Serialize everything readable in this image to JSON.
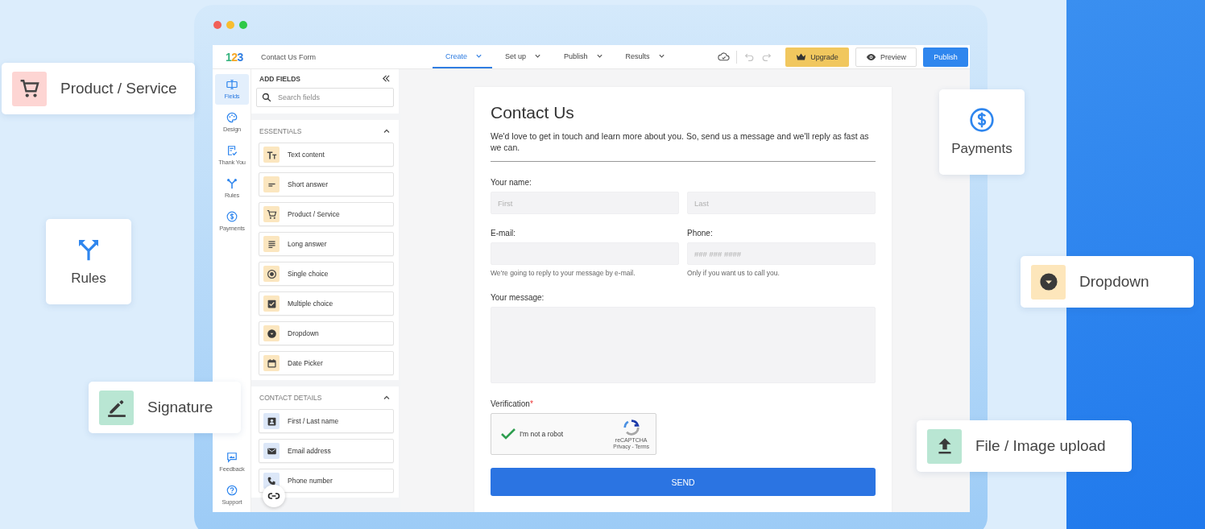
{
  "window": {
    "title": "Contact Us Form"
  },
  "logo": "123",
  "tabs": [
    {
      "label": "Create",
      "selected": true
    },
    {
      "label": "Set up",
      "selected": false
    },
    {
      "label": "Publish",
      "selected": false
    },
    {
      "label": "Results",
      "selected": false
    }
  ],
  "toolbar_buttons": [
    {
      "kind": "upgrade",
      "label": "Upgrade"
    },
    {
      "kind": "preview",
      "label": "Preview"
    },
    {
      "kind": "publish",
      "label": "Publish"
    }
  ],
  "rail": {
    "top_items": [
      {
        "label": "Fields",
        "selected": true
      },
      {
        "label": "Design",
        "selected": false
      },
      {
        "label": "Thank You",
        "selected": false
      },
      {
        "label": "Rules",
        "selected": false
      },
      {
        "label": "Payments",
        "selected": false
      }
    ],
    "bottom_items": [
      {
        "label": "Feedback",
        "selected": false
      },
      {
        "label": "Support",
        "selected": false
      }
    ]
  },
  "fields_panel": {
    "title": "ADD FIELDS",
    "search": {
      "placeholder": "Search fields"
    },
    "groups": [
      {
        "title": "ESSENTIALS",
        "expanded": true,
        "items": [
          "Text content",
          "Short answer",
          "Product / Service",
          "Long answer",
          "Single choice",
          "Multiple choice",
          "Dropdown",
          "Date Picker"
        ]
      },
      {
        "title": "CONTACT DETAILS",
        "expanded": true,
        "items": [
          "First / Last name",
          "Email address",
          "Phone number"
        ]
      }
    ]
  },
  "form": {
    "title": "Contact Us",
    "description": "We'd love to get in touch and learn more about you. So, send us a message and we'll reply as fast as we can.",
    "name_field": {
      "label": "Your name:",
      "first_placeholder": "First",
      "last_placeholder": "Last"
    },
    "email_field": {
      "label": "E-mail:",
      "hint": "We're going to reply to your message by e-mail."
    },
    "phone_field": {
      "label": "Phone:",
      "placeholder": "### ### ####",
      "hint": "Only if you want us to call you."
    },
    "message_field": {
      "label": "Your message:"
    },
    "verification": {
      "label": "Verification",
      "required_mark": "*",
      "captcha": {
        "checked": true,
        "label": "I'm not a robot",
        "brand": "reCAPTCHA",
        "links": "Privacy - Terms"
      }
    },
    "submit": "SEND"
  },
  "floating_cards": [
    {
      "kind": "row",
      "label": "Product / Service"
    },
    {
      "kind": "tile",
      "label": "Rules"
    },
    {
      "kind": "row",
      "label": "Signature"
    },
    {
      "kind": "tile",
      "label": "Payments"
    },
    {
      "kind": "row",
      "label": "Dropdown"
    },
    {
      "kind": "row",
      "label": "File / Image upload"
    }
  ]
}
